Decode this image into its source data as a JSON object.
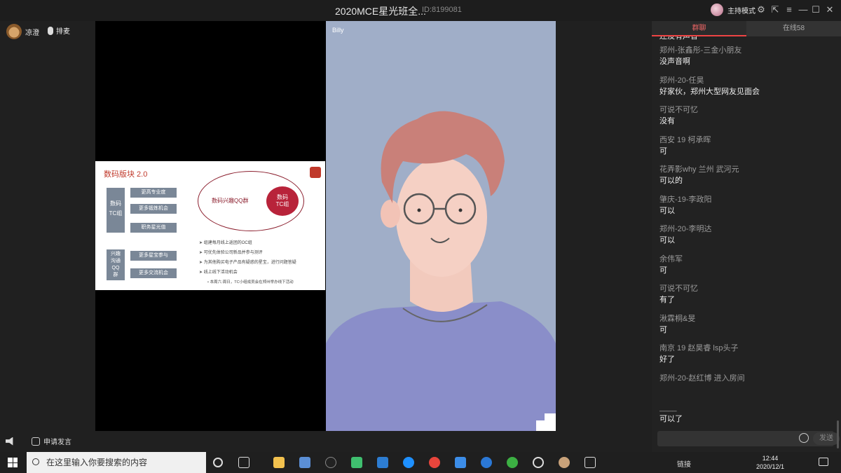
{
  "window": {
    "title": "2020MCE星光班全...",
    "room_id": "ID:8199081",
    "host_mode": "主持模式"
  },
  "toolbar": {
    "user_name": "凉澄",
    "mic_label": "排麦",
    "speaker_request": "申请发言"
  },
  "slide": {
    "title": "数码版块 2.0",
    "tc_group": "数码\nTC组",
    "actions": [
      "更高专业度",
      "更多锻炼机会",
      "职务星光值"
    ],
    "interest_group": "兴趣\n沟通\nQQ\n群",
    "interest_actions": [
      "更多星宝参与",
      "更多交流机会"
    ],
    "ellipse_label": "数码兴趣QQ群",
    "dot_label": "数码\nTC组",
    "bullets": [
      "组建每月线上返团的OC组",
      "可优先体验公司新品并参与测评",
      "为其他购买电子产品有疑惑的星宝，进行问题答疑",
      "线上线下活动机会"
    ],
    "sub_bullet": "本周六·周日，TC小组成员会在郑州举办线下活动"
  },
  "video": {
    "participant": "Billy"
  },
  "chat": {
    "tabs": [
      "群聊",
      "在线58"
    ],
    "partial_top": "还没有声音",
    "messages": [
      {
        "user": "郑州-张鑫彤-三金小朋友",
        "text": "没声音啊"
      },
      {
        "user": "郑州-20-任昊",
        "text": "好家伙，郑州大型网友见面会"
      },
      {
        "user": "可说不可忆",
        "text": "没有"
      },
      {
        "user": "西安 19 柯承晖",
        "text": "可"
      },
      {
        "user": "花弄影why 兰州 武河元",
        "text": "可以的"
      },
      {
        "user": "肇庆-19-李政阳",
        "text": "可以"
      },
      {
        "user": "郑州-20-李明达",
        "text": "可以"
      },
      {
        "user": "余伟军",
        "text": "可"
      },
      {
        "user": "可说不可忆",
        "text": "有了"
      },
      {
        "user": "湫霖桐&旻",
        "text": "可"
      },
      {
        "user": "南京 19 赵昊睿 lsp头子",
        "text": "好了"
      },
      {
        "user": "郑州-20-赵红博 进入房间",
        "text": ""
      },
      {
        "user": "____",
        "text": "可以了"
      }
    ],
    "send_label": "发送"
  },
  "taskbar": {
    "search_placeholder": "在这里输入你要搜索的内容",
    "tray_text": "链接",
    "time": "12:44",
    "date": "2020/12/1"
  },
  "colors": {
    "accent": "#e44a4a",
    "slide_red": "#b8233a",
    "video_bg": "#a0aec8",
    "shirt": "#8a8ec9",
    "hair": "#c98079"
  }
}
